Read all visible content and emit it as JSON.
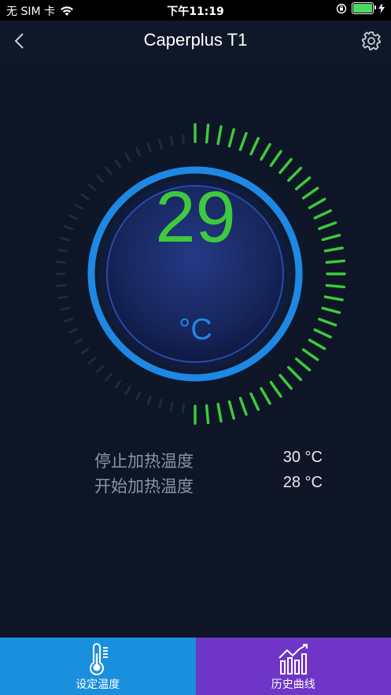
{
  "status_bar": {
    "carrier": "无 SIM 卡",
    "time": "下午11:19"
  },
  "nav": {
    "title": "Caperplus T1"
  },
  "gauge": {
    "current_temp": "29",
    "unit": "°C",
    "progress_fraction": 0.5
  },
  "info": {
    "stop_heating_label": "停止加热温度",
    "stop_heating_value": "30 °C",
    "start_heating_label": "开始加热温度",
    "start_heating_value": "28 °C"
  },
  "tabs": [
    {
      "label": "设定温度",
      "icon": "thermometer-icon"
    },
    {
      "label": "历史曲线",
      "icon": "chart-icon"
    }
  ],
  "colors": {
    "background": "#0d1526",
    "accent_green": "#3ec93e",
    "accent_blue": "#1e88e5",
    "tab_blue": "#1a8fdd",
    "tab_purple": "#6e35c7"
  }
}
